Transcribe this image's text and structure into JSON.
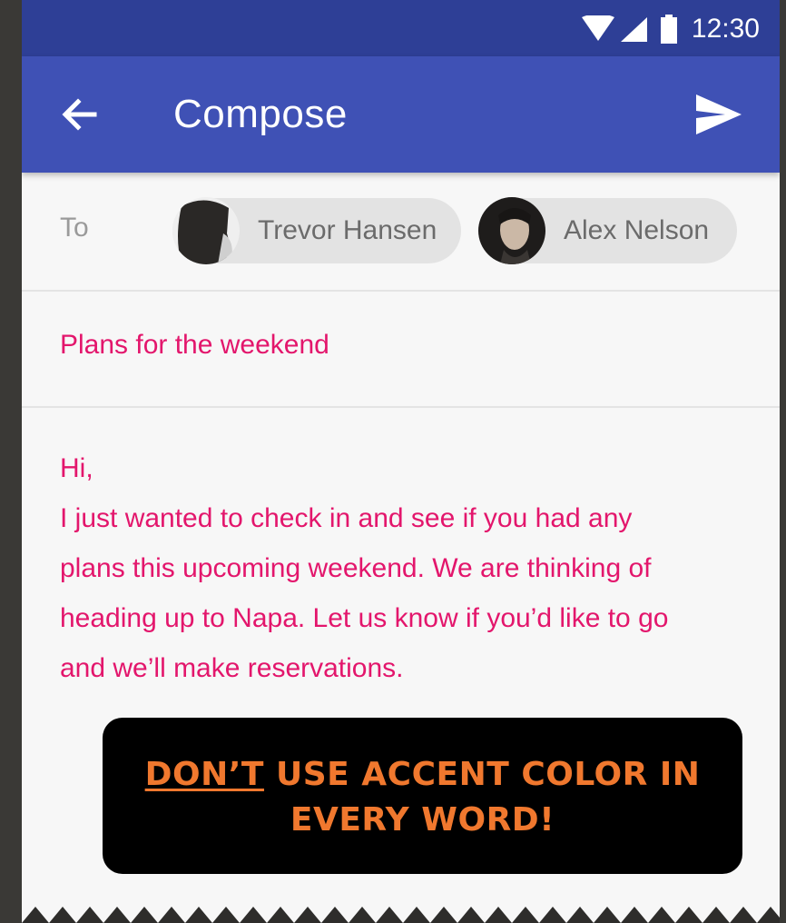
{
  "status_bar": {
    "time": "12:30",
    "icons": [
      "wifi-icon",
      "signal-icon",
      "battery-icon"
    ]
  },
  "app_bar": {
    "title": "Compose",
    "back_icon": "arrow-back-icon",
    "send_icon": "send-icon"
  },
  "compose": {
    "to_label": "To",
    "recipients": [
      {
        "name": "Trevor Hansen"
      },
      {
        "name": "Alex Nelson"
      }
    ],
    "subject": "Plans for the weekend",
    "body_lines": [
      "Hi,",
      "I just wanted to check in and see if you had any",
      "plans this upcoming weekend. We are thinking of",
      "heading up to Napa. Let us know if you’d like to go",
      "and we’ll make reservations."
    ]
  },
  "warning": {
    "emphasis": "DON’T",
    "line1_rest": " USE ACCENT COLOR IN",
    "line2": "EVERY WORD!"
  },
  "colors": {
    "primary": "#3f51b5",
    "primary_dark": "#2e3f96",
    "accent": "#e3166c",
    "warning_text": "#f0782e"
  }
}
